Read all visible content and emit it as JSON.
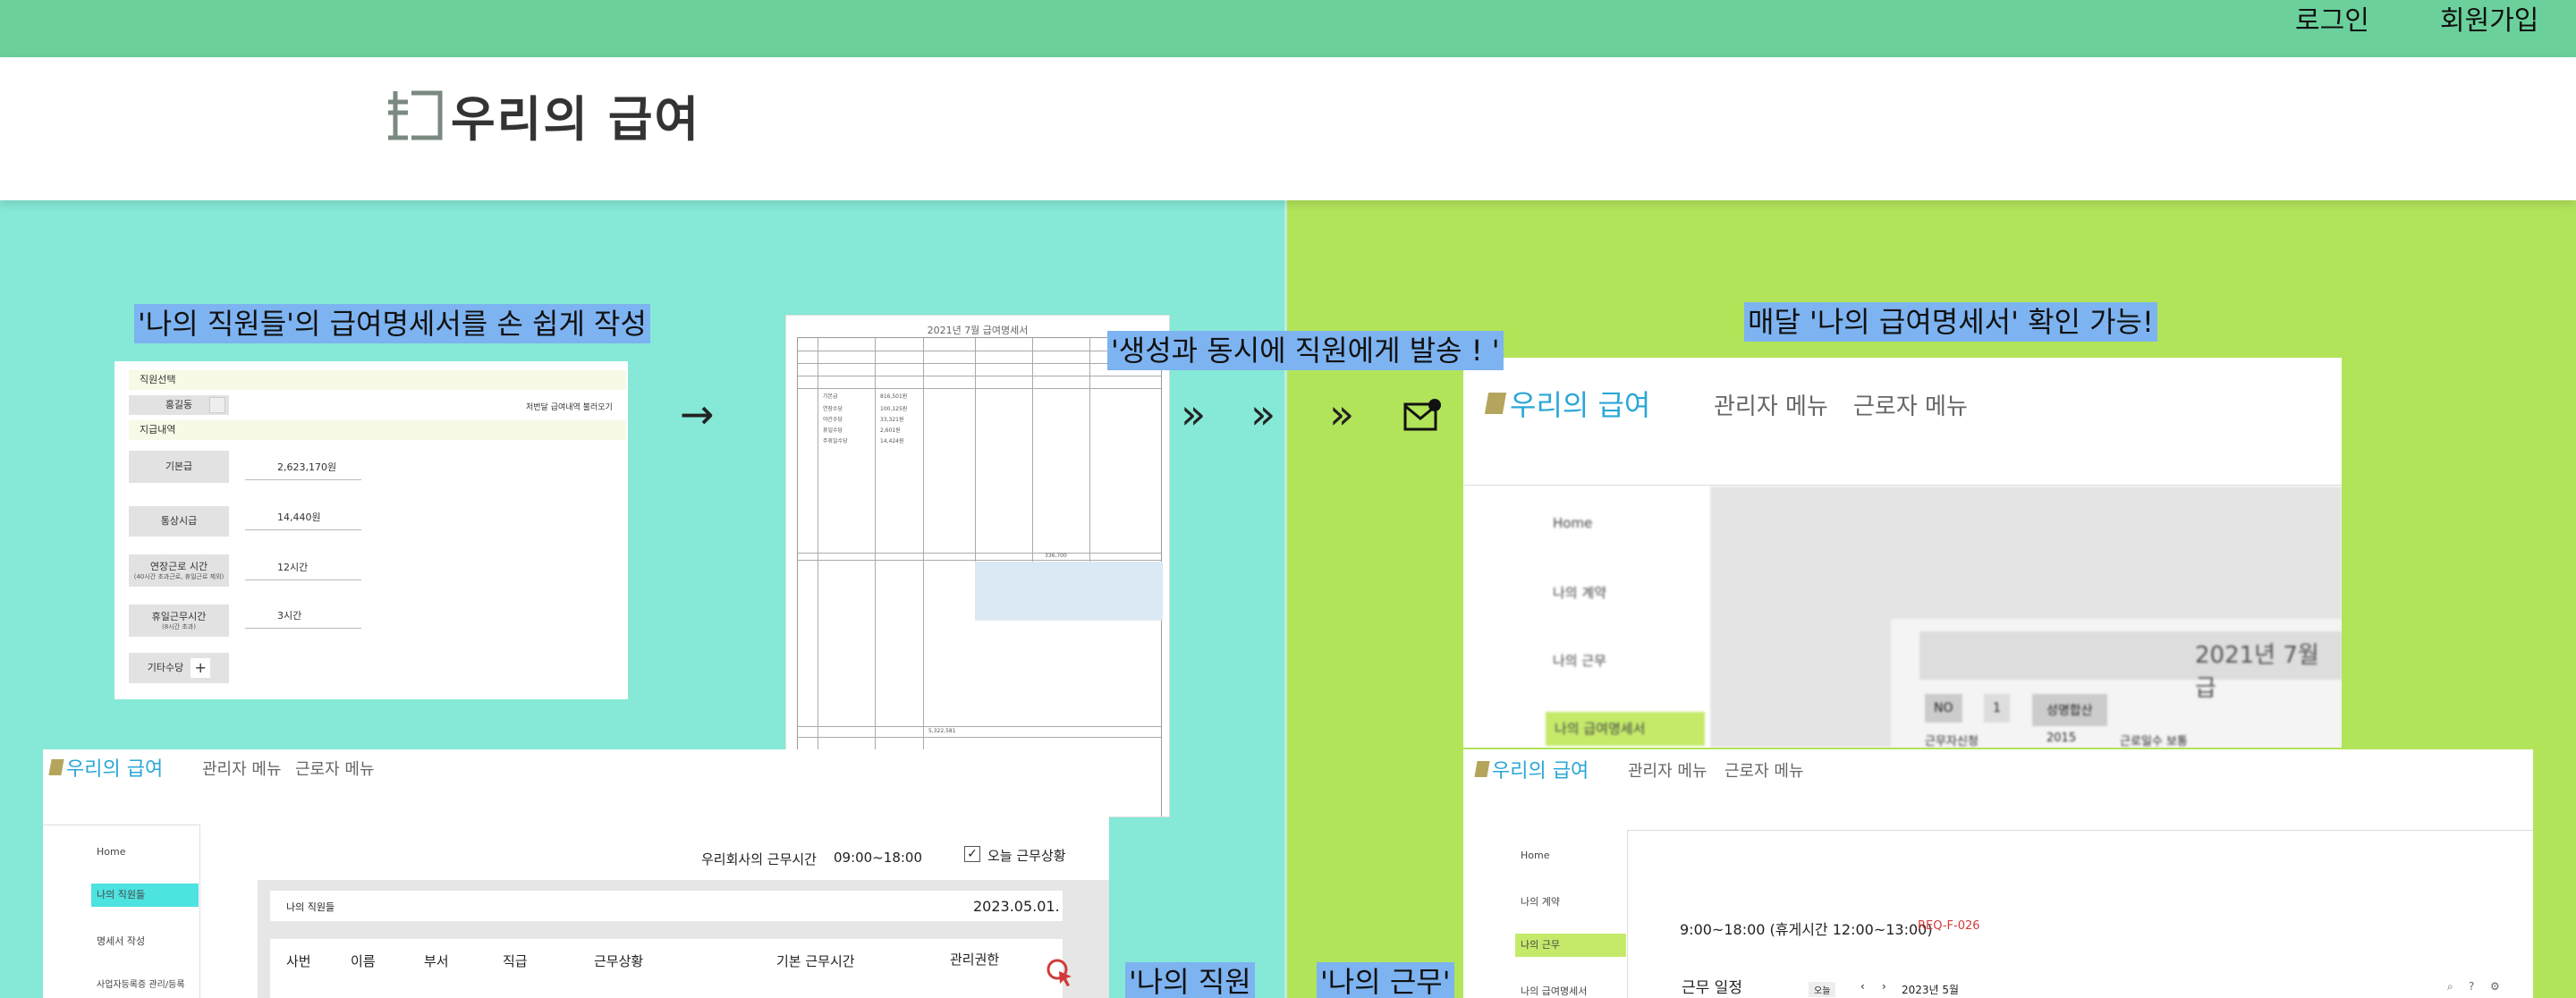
{
  "top_nav": {
    "login": "로그인",
    "signup": "회원가입"
  },
  "brand": {
    "name": "우리의 급여"
  },
  "left_panel": {
    "caption_1": "'나의 직원들'의 급여명세서를 손 쉽게 작성",
    "caption_2": "'생성과 동시에 직원에게 발송 ! '",
    "caption_bottom": "'나의 직원",
    "arrow": "→",
    "chevrons": [
      "»",
      "»",
      "»"
    ]
  },
  "right_panel": {
    "caption_1": "매달 '나의 급여명세서' 확인 가능!",
    "caption_bottom": "'나의 근무'"
  },
  "form_shot": {
    "band_1": "직원선택",
    "employee": "홍길동",
    "load_link": "저번달 급여내역 불러오기",
    "band_2": "지급내역",
    "rows": [
      {
        "label": "기본급",
        "sub": "",
        "value": "2,623,170원"
      },
      {
        "label": "통상시급",
        "sub": "",
        "value": "14,440원"
      },
      {
        "label": "연장근로 시간",
        "sub": "(40시간 초과근로, 휴일근로 제외)",
        "value": "12시간"
      },
      {
        "label": "휴일근무시간",
        "sub": "(8시간 초과)",
        "value": "3시간"
      }
    ],
    "extra": "기타수당",
    "plus": "+"
  },
  "payslip_shot": {
    "title": "2021년 7월 급여명세서",
    "deduction_total": "336,700",
    "pay_total": "5,322,581",
    "sample_rows": [
      "기본급",
      "연장수당",
      "야간수당",
      "휴일수당",
      "주휴일수당"
    ],
    "sample_values": [
      "816,501원",
      "100,125원",
      "33,321원",
      "2,601원",
      "14,424원"
    ]
  },
  "app_top_right": {
    "brand": "우리의 급여",
    "menu_admin": "관리자 메뉴",
    "menu_worker": "근로자 메뉴",
    "side": [
      "Home",
      "나의 계약",
      "나의 근무",
      "나의 급여명세서"
    ],
    "doc_title": "2021년 7월 급",
    "doc_cells": [
      "NO",
      "1",
      "성명합산",
      "근무자신청",
      "2015",
      "근로일수 보통"
    ]
  },
  "app_bottom_left": {
    "brand": "우리의 급여",
    "menu_admin": "관리자 메뉴",
    "menu_worker": "근로자 메뉴",
    "side": [
      "Home",
      "나의 직원들",
      "명세서 작성",
      "사업자등록증 관리/등록"
    ],
    "worktime_label": "우리회사의 근무시간",
    "worktime_value": "09:00~18:00",
    "today_status": "오늘 근무상황",
    "staff_label": "나의 직원들",
    "date": "2023.05.01.",
    "columns": [
      "사번",
      "이름",
      "부서",
      "직급",
      "근무상황",
      "기본 근무시간",
      "관리권한"
    ]
  },
  "app_bottom_right": {
    "brand": "우리의 급여",
    "menu_admin": "관리자 메뉴",
    "menu_worker": "근로자 메뉴",
    "side": [
      "Home",
      "나의 계약",
      "나의 근무",
      "나의 급여명세서"
    ],
    "schedule": "9:00~18:00 (휴게시간 12:00~13:00)",
    "req_code": "REQ-F-026",
    "schedule_title": "근무 일정",
    "today_btn": "오늘",
    "month": "2023년 5월"
  },
  "colors": {
    "topbar": "#6bd09b",
    "left_panel": "#86e8d6",
    "right_panel": "#b2e45a",
    "caption": "#7db3f0",
    "brand_blue": "#2aa7d6"
  }
}
